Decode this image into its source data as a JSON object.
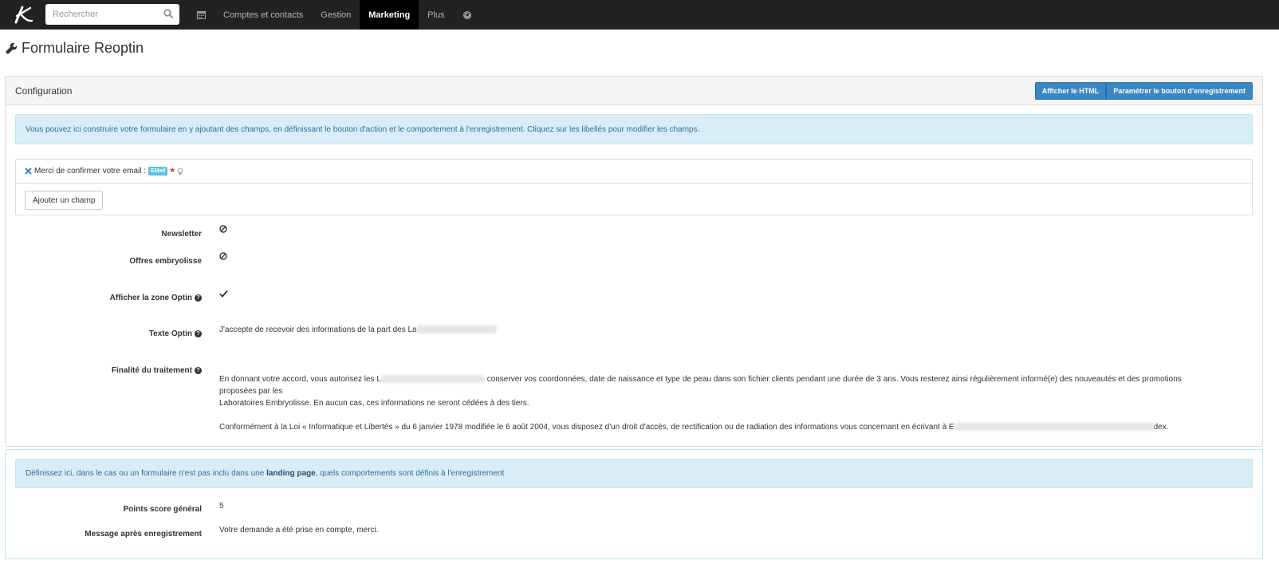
{
  "nav": {
    "search_placeholder": "Rechercher",
    "items": [
      {
        "label": "Comptes et contacts"
      },
      {
        "label": "Gestion"
      },
      {
        "label": "Marketing"
      },
      {
        "label": "Plus"
      }
    ]
  },
  "page": {
    "title": "Formulaire Reoptin"
  },
  "config": {
    "heading": "Configuration",
    "btn_html": "Afficher le HTML",
    "btn_save_settings": "Paramétrer le bouton d'enregistrement",
    "info": "Vous pouvez ici construire votre formulaire en y ajoutant des champs, en définissant le bouton d'action et le comportement à l'enregistrement. Cliquez sur les libellés pour modifier les champs.",
    "field_label": "Merci de confirmer votre email :",
    "field_badge": "EMail",
    "add_field": "Ajouter un champ",
    "newsletter_label": "Newsletter",
    "offres_label": "Offres embryolisse",
    "optin_zone_label": "Afficher la zone Optin",
    "optin_text_label": "Texte Optin",
    "optin_text_value": "J'accepte de recevoir des informations de la part des La",
    "finalite_label": "Finalité du traitement",
    "finalite_p1a": "En donnant votre accord, vous autorisez les L",
    "finalite_p1b": "conserver vos coordonnées, date de naissance et type de peau dans son fichier clients pendant une durée de 3 ans. Vous resterez ainsi régulièrement informé(e) des nouveautés et des promotions proposées par les",
    "finalite_p1c": "Laboratoires Embryolisse. En aucun cas, ces informations ne seront cédées à des tiers.",
    "finalite_p2a": "Conformément à la Loi « Informatique et Libertés » du 6 janvier 1978 modifiée le 6 août 2004, vous disposez d'un droit d'accès, de rectification ou de radiation des informations vous concernant en écrivant à E",
    "finalite_p2b": "dex."
  },
  "behaviour": {
    "info_a": "Définissez ici, dans le cas ou un formulaire n'est pas inclu dans une ",
    "info_link": "landing page",
    "info_b": ", quels comportements sont définis à l'enregistrement",
    "score_label": "Points score général",
    "score_value": "5",
    "message_label": "Message après enregistrement",
    "message_value": "Votre demande a été prise en compte, merci."
  }
}
